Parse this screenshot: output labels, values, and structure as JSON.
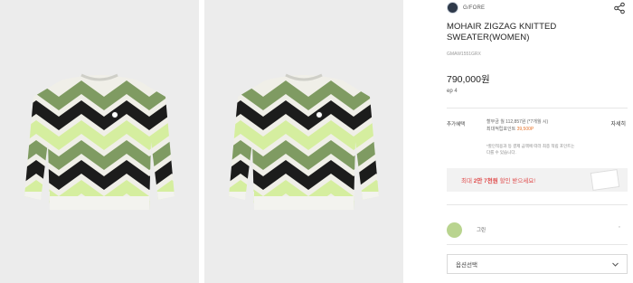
{
  "gallery": {
    "images": [
      {
        "alt": "sweater-front-1"
      },
      {
        "alt": "sweater-front-2"
      }
    ],
    "colors": {
      "cream": "#f0efe8",
      "sage": "#7f9b62",
      "lime": "#d5ee9f",
      "black": "#1c1c1c"
    }
  },
  "product": {
    "brand": "G/FORE",
    "title": "MOHAIR ZIGZAG KNITTED SWEATER(WOMEN)",
    "sku": "GMAW1551GRX",
    "price": "790,000원",
    "points_prefix": "ep",
    "points_value": "4"
  },
  "benefits": {
    "label": "추가혜택",
    "line1": "할부금 월 112,857원 (*7개월 시)",
    "line2_label": "최대적립포인트",
    "line2_value": "39,500P",
    "detail_link": "자세히",
    "note": "*할인적용과 등 결제 금액에 따라 최종 적립 포인트는 다를 수 있습니다."
  },
  "coupon": {
    "text_prefix": "최대 ",
    "text_strong": "2만 7천원",
    "text_suffix": " 할인 받으세요!",
    "accent": "#e04b4b"
  },
  "color_option": {
    "swatch_color": "#b9d48f",
    "label": "그린",
    "more": "◦"
  },
  "option_select": {
    "placeholder": "옵션선택"
  }
}
